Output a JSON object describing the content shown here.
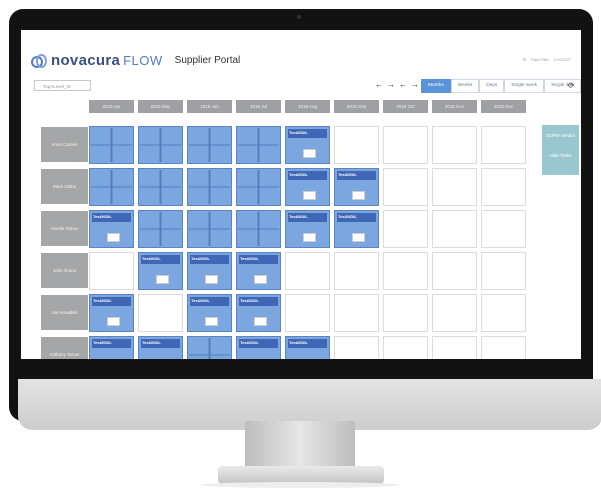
{
  "app": {
    "brand": "novacura",
    "brand_suffix": "FLOW",
    "title": "Supplier Portal",
    "user": "Paul Piller",
    "logout": "LOGOUT"
  },
  "search": {
    "value": "TopALevel_ID"
  },
  "toolbar": {
    "buttons": [
      "Months",
      "Weeks",
      "Days",
      "Single week",
      "Single day"
    ],
    "active": "Months"
  },
  "months": [
    "2018 Apr",
    "2018 May",
    "2018 Jun",
    "2018 Jul",
    "2018 Aug",
    "2018 Sep",
    "2018 Oct",
    "2018 Nov",
    "2018 Dec"
  ],
  "rows": [
    {
      "label": "Anna Carsen",
      "cells": [
        "f",
        "f",
        "f",
        "f",
        "c",
        "e",
        "e",
        "e",
        "e"
      ]
    },
    {
      "label": "Mark Gibbs",
      "cells": [
        "f",
        "f",
        "f",
        "f",
        "c",
        "c",
        "e",
        "e",
        "e"
      ]
    },
    {
      "label": "Amelie Osbox",
      "cells": [
        "c",
        "f",
        "f",
        "f",
        "c",
        "c",
        "e",
        "e",
        "e"
      ]
    },
    {
      "label": "John Grace",
      "cells": [
        "e",
        "c",
        "c",
        "c",
        "e",
        "e",
        "e",
        "e",
        "e"
      ]
    },
    {
      "label": "Joe Kowalski",
      "cells": [
        "c",
        "e",
        "c",
        "c",
        "e",
        "e",
        "e",
        "e",
        "e"
      ]
    },
    {
      "label": "Anthony Tarver",
      "cells": [
        "c",
        "c",
        "f",
        "c",
        "c",
        "e",
        "e",
        "e",
        "e"
      ]
    }
  ],
  "card_titles": [
    "Test20DIL"
  ],
  "side_panel": {
    "btn1": "OOPM Vendor",
    "btn2": "Hide Tasks"
  },
  "colors": {
    "accent": "#5b93d9",
    "cell_fill": "#7ba6e0",
    "header_bg": "#9fa0a3"
  }
}
